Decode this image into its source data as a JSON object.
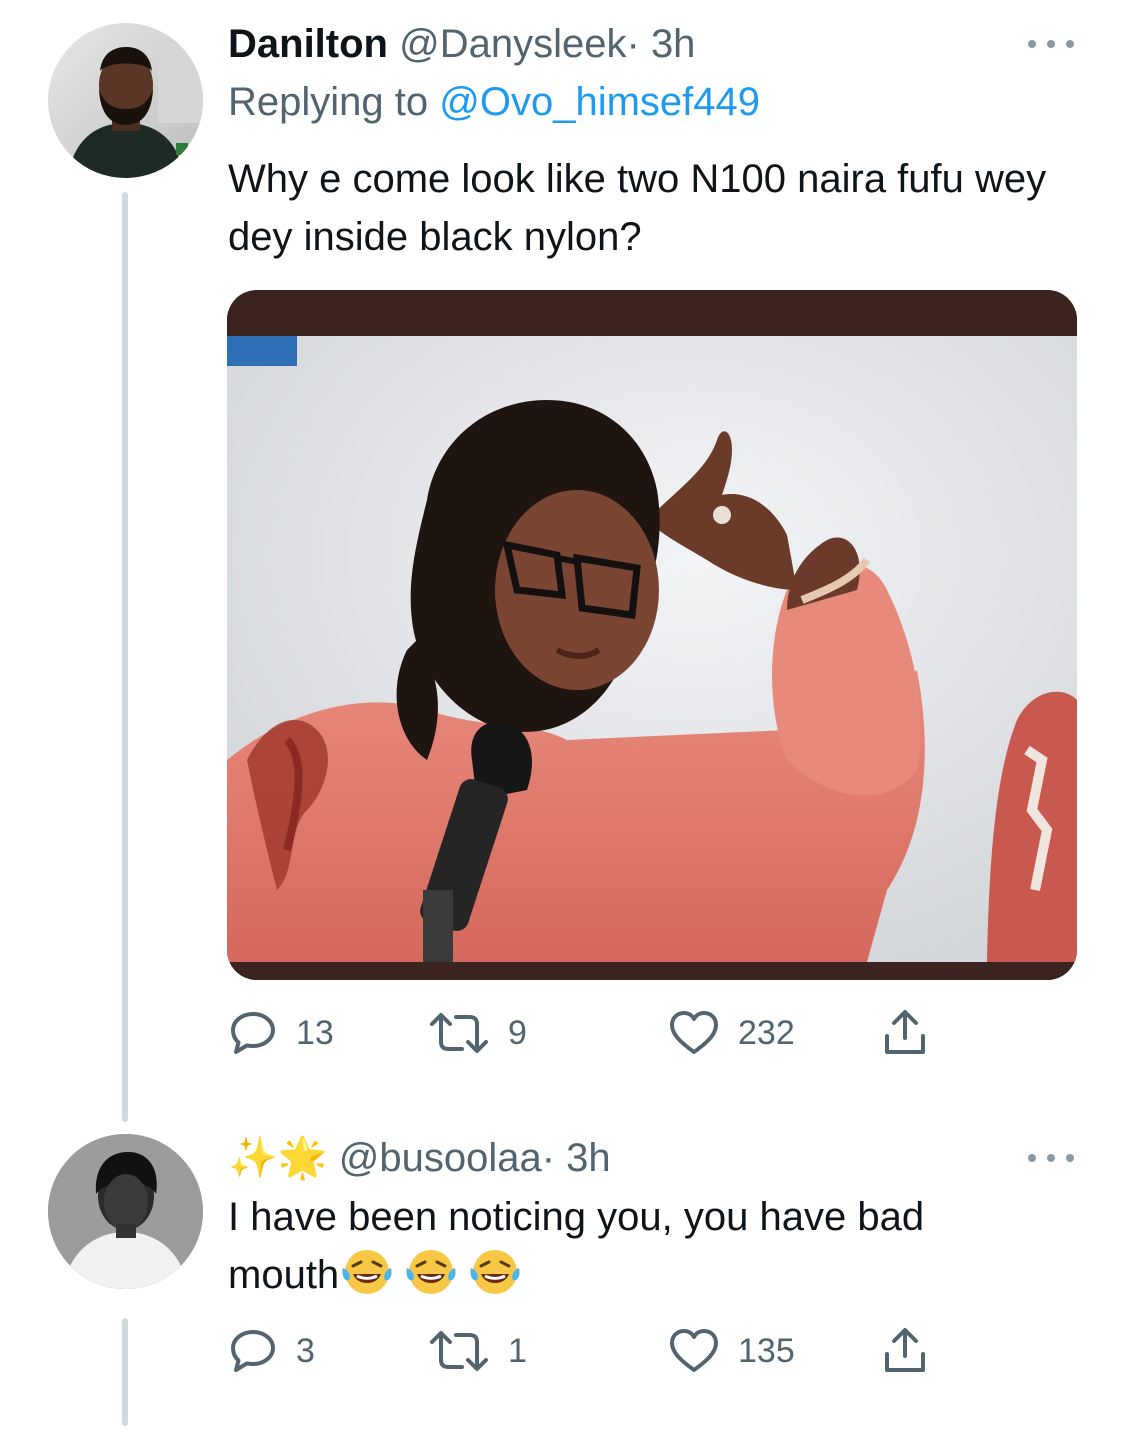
{
  "tweet1": {
    "display_name": "Danilton",
    "handle": "@Danysleek",
    "separator": "·",
    "time": "3h",
    "replying_prefix": "Replying to",
    "replying_to": "@Ovo_himsef449",
    "text": "Why e come look like two N100 naira fufu wey dey inside black nylon?",
    "replies": "13",
    "retweets": "9",
    "likes": "232"
  },
  "tweet2": {
    "display_name": "✨🌟",
    "handle": "@busoolaa",
    "separator": "·",
    "time": "3h",
    "text_line1": "I have been noticing you, you have bad",
    "text_line2": "mouth",
    "text_emoji": "😂😂😂",
    "replies": "3",
    "retweets": "1",
    "likes": "135"
  },
  "colors": {
    "link_blue": "#1d9bf0",
    "secondary_text": "#536471",
    "primary_text": "#0f1419",
    "thread_line": "#cfd9de"
  },
  "icons": {
    "reply": "speech-bubble-icon",
    "retweet": "retweet-arrows-icon",
    "like": "heart-icon",
    "share": "share-upload-icon",
    "more": "more-dots-icon"
  }
}
